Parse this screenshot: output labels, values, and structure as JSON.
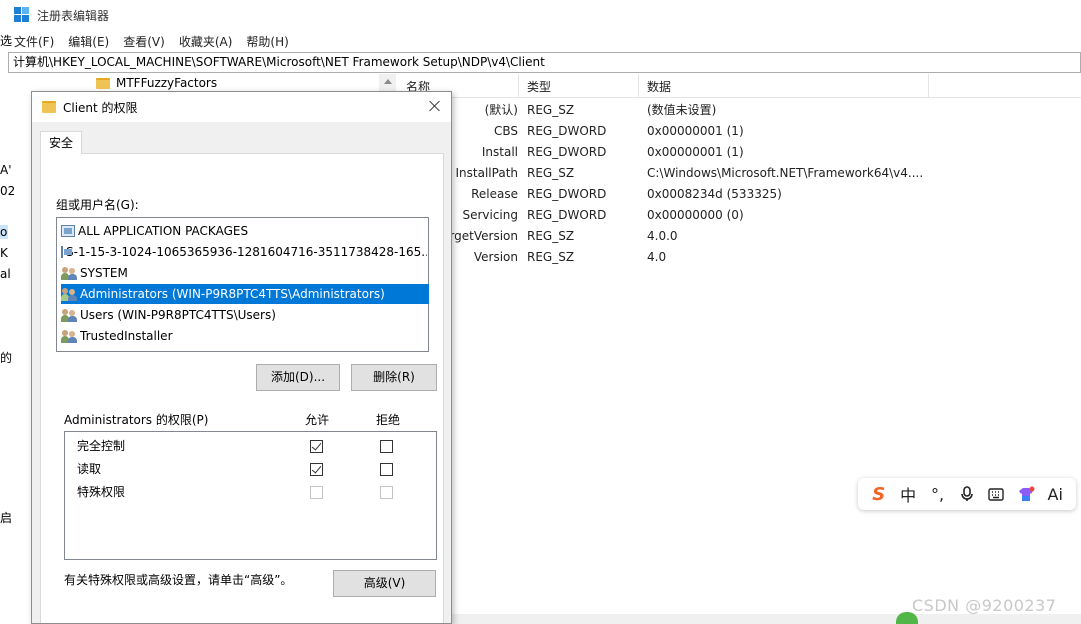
{
  "window": {
    "title": "注册表编辑器",
    "menu": [
      "文件(F)",
      "编辑(E)",
      "查看(V)",
      "收藏夹(A)",
      "帮助(H)"
    ],
    "address": "计算机\\HKEY_LOCAL_MACHINE\\SOFTWARE\\Microsoft\\NET Framework Setup\\NDP\\v4\\Client"
  },
  "left_fragments": [
    "选",
    "A'",
    "02",
    "o",
    "K",
    "al",
    "的",
    "启"
  ],
  "tree": {
    "visible_item": "MTFFuzzyFactors"
  },
  "values": {
    "headers": [
      "名称",
      "类型",
      "数据"
    ],
    "rows": [
      {
        "name": "(默认)",
        "type": "REG_SZ",
        "data": "(数值未设置)"
      },
      {
        "name": "CBS",
        "type": "REG_DWORD",
        "data": "0x00000001 (1)"
      },
      {
        "name": "Install",
        "type": "REG_DWORD",
        "data": "0x00000001 (1)"
      },
      {
        "name": "InstallPath",
        "type": "REG_SZ",
        "data": "C:\\Windows\\Microsoft.NET\\Framework64\\v4...."
      },
      {
        "name": "Release",
        "type": "REG_DWORD",
        "data": "0x0008234d (533325)"
      },
      {
        "name": "Servicing",
        "type": "REG_DWORD",
        "data": "0x00000000 (0)"
      },
      {
        "name": "TargetVersion",
        "type": "REG_SZ",
        "data": "4.0.0"
      },
      {
        "name": "Version",
        "type": "REG_SZ",
        "data": "4.0"
      }
    ]
  },
  "dialog": {
    "title": "Client 的权限",
    "tab": "安全",
    "group_label": "组或用户名(G):",
    "users": [
      {
        "name": "ALL APPLICATION PACKAGES",
        "icon": "package-icon",
        "selected": false
      },
      {
        "name": "S-1-15-3-1024-1065365936-1281604716-3511738428-165...",
        "icon": "package-icon",
        "selected": false
      },
      {
        "name": "SYSTEM",
        "icon": "users-icon",
        "selected": false
      },
      {
        "name": "Administrators (WIN-P9R8PTC4TTS\\Administrators)",
        "icon": "users-icon",
        "selected": true
      },
      {
        "name": "Users (WIN-P9R8PTC4TTS\\Users)",
        "icon": "users-icon",
        "selected": false
      },
      {
        "name": "TrustedInstaller",
        "icon": "users-icon",
        "selected": false
      }
    ],
    "add_button": "添加(D)...",
    "remove_button": "删除(R)",
    "perm_label": "Administrators 的权限(P)",
    "allow_header": "允许",
    "deny_header": "拒绝",
    "permissions": [
      {
        "name": "完全控制",
        "allow": true,
        "deny": false,
        "enabled": true
      },
      {
        "name": "读取",
        "allow": true,
        "deny": false,
        "enabled": true
      },
      {
        "name": "特殊权限",
        "allow": false,
        "deny": false,
        "enabled": false
      }
    ],
    "advanced_note": "有关特殊权限或高级设置，请单击“高级”。",
    "advanced_button": "高级(V)"
  },
  "ime": {
    "items": [
      "sogou-logo-icon",
      "中",
      "°,",
      "microphone-icon",
      "keyboard-icon",
      "skin-icon",
      "Ai"
    ]
  },
  "watermark": "CSDN @9200237",
  "colors": {
    "selection": "#0078d7",
    "dialog_bg": "#f0f0f0",
    "folder": "#f0c454",
    "sogou": "#f26522"
  }
}
